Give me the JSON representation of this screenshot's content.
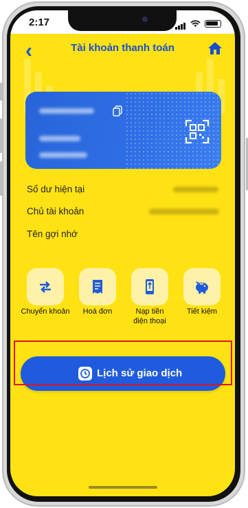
{
  "status_bar": {
    "time": "2:17"
  },
  "header": {
    "title": "Tài khoản thanh toán"
  },
  "account_info": {
    "balance_label": "Số dư hiện tại",
    "owner_label": "Chủ tài khoản",
    "nickname_label": "Tên gợi nhớ"
  },
  "actions": [
    {
      "label": "Chuyển khoản",
      "icon": "transfer-icon"
    },
    {
      "label": "Hoá đơn",
      "icon": "bill-icon"
    },
    {
      "label_line1": "Nạp tiền",
      "label_line2": "điện thoại",
      "icon": "phone-topup-icon"
    },
    {
      "label": "Tiết kiệm",
      "icon": "piggy-bank-icon"
    }
  ],
  "history_button": {
    "label": "Lịch sử giao dịch",
    "icon": "clock-icon"
  },
  "colors": {
    "background": "#ffe214",
    "primary": "#1f5bdc",
    "highlight": "#e21212"
  }
}
